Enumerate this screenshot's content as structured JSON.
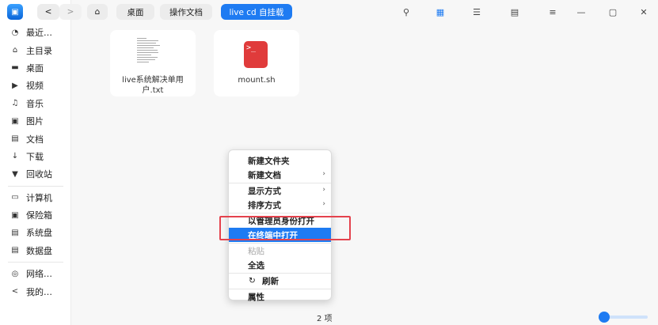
{
  "sidebar": {
    "items": [
      {
        "label": "最近…",
        "icon": "clock-icon",
        "glyph": "◔"
      },
      {
        "label": "主目录",
        "icon": "home-icon",
        "glyph": "⌂"
      },
      {
        "label": "桌面",
        "icon": "desktop-icon",
        "glyph": "▬"
      },
      {
        "label": "视频",
        "icon": "video-icon",
        "glyph": "▶"
      },
      {
        "label": "音乐",
        "icon": "music-icon",
        "glyph": "♫"
      },
      {
        "label": "图片",
        "icon": "picture-icon",
        "glyph": "▣"
      },
      {
        "label": "文档",
        "icon": "document-icon",
        "glyph": "▤"
      },
      {
        "label": "下载",
        "icon": "download-icon",
        "glyph": "↓"
      },
      {
        "label": "回收站",
        "icon": "trash-icon",
        "glyph": "▼"
      }
    ],
    "devices": [
      {
        "label": "计算机",
        "icon": "computer-icon",
        "glyph": "▭"
      },
      {
        "label": "保险箱",
        "icon": "safe-icon",
        "glyph": "▣"
      },
      {
        "label": "系统盘",
        "icon": "disk-icon",
        "glyph": "▤"
      },
      {
        "label": "数据盘",
        "icon": "disk-icon",
        "glyph": "▤"
      }
    ],
    "network": [
      {
        "label": "网络…",
        "icon": "network-icon",
        "glyph": "◎"
      },
      {
        "label": "我的…",
        "icon": "share-icon",
        "glyph": "<"
      }
    ]
  },
  "toolbar": {
    "back_glyph": "<",
    "forward_glyph": ">",
    "home_glyph": "⌂",
    "breadcrumbs": [
      "桌面",
      "操作文档",
      "live cd 自挂载"
    ],
    "search_glyph": "⚲",
    "icon_view_glyph": "▦",
    "list_view_glyph": "☰",
    "detail_view_glyph": "▤",
    "menu_glyph": "≡",
    "minimize_glyph": "—",
    "maximize_glyph": "▢",
    "close_glyph": "✕"
  },
  "files": [
    {
      "name": "live系统解决单用户.txt",
      "type": "text-file"
    },
    {
      "name": "mount.sh",
      "type": "shell-script",
      "thumb": ">_"
    }
  ],
  "context_menu": {
    "new_folder": "新建文件夹",
    "new_document": "新建文档",
    "display_mode": "显示方式",
    "sort_by": "排序方式",
    "open_as_admin": "以管理员身份打开",
    "open_in_terminal": "在终端中打开",
    "paste": "粘贴",
    "select_all": "全选",
    "refresh": "刷新",
    "refresh_glyph": "↻",
    "properties": "属性",
    "submenu_arrow": "›"
  },
  "status": {
    "item_count": "2 项"
  },
  "colors": {
    "accent": "#1e7bf2",
    "highlight_box": "#e4424d"
  }
}
